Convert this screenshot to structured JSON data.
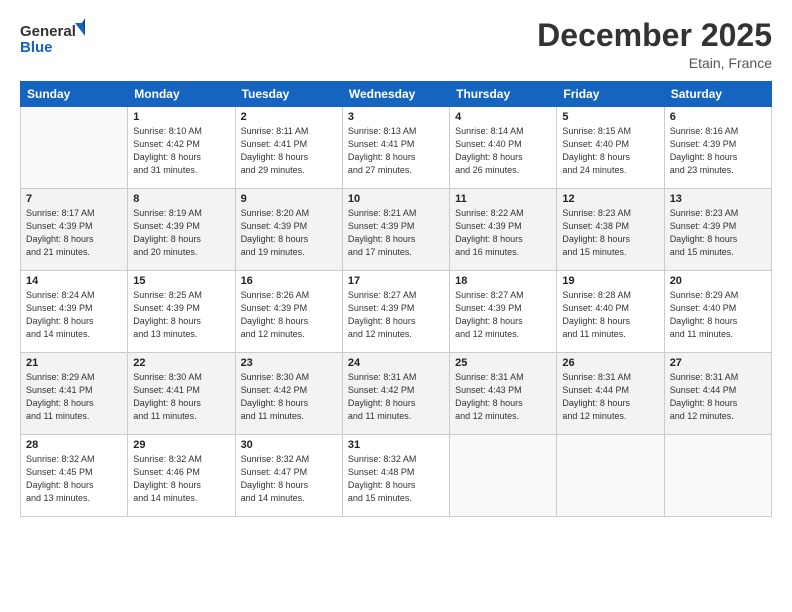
{
  "header": {
    "logo_line1": "General",
    "logo_line2": "Blue",
    "month": "December 2025",
    "location": "Etain, France"
  },
  "weekdays": [
    "Sunday",
    "Monday",
    "Tuesday",
    "Wednesday",
    "Thursday",
    "Friday",
    "Saturday"
  ],
  "weeks": [
    [
      {
        "day": "",
        "info": ""
      },
      {
        "day": "1",
        "info": "Sunrise: 8:10 AM\nSunset: 4:42 PM\nDaylight: 8 hours\nand 31 minutes."
      },
      {
        "day": "2",
        "info": "Sunrise: 8:11 AM\nSunset: 4:41 PM\nDaylight: 8 hours\nand 29 minutes."
      },
      {
        "day": "3",
        "info": "Sunrise: 8:13 AM\nSunset: 4:41 PM\nDaylight: 8 hours\nand 27 minutes."
      },
      {
        "day": "4",
        "info": "Sunrise: 8:14 AM\nSunset: 4:40 PM\nDaylight: 8 hours\nand 26 minutes."
      },
      {
        "day": "5",
        "info": "Sunrise: 8:15 AM\nSunset: 4:40 PM\nDaylight: 8 hours\nand 24 minutes."
      },
      {
        "day": "6",
        "info": "Sunrise: 8:16 AM\nSunset: 4:39 PM\nDaylight: 8 hours\nand 23 minutes."
      }
    ],
    [
      {
        "day": "7",
        "info": "Sunrise: 8:17 AM\nSunset: 4:39 PM\nDaylight: 8 hours\nand 21 minutes."
      },
      {
        "day": "8",
        "info": "Sunrise: 8:19 AM\nSunset: 4:39 PM\nDaylight: 8 hours\nand 20 minutes."
      },
      {
        "day": "9",
        "info": "Sunrise: 8:20 AM\nSunset: 4:39 PM\nDaylight: 8 hours\nand 19 minutes."
      },
      {
        "day": "10",
        "info": "Sunrise: 8:21 AM\nSunset: 4:39 PM\nDaylight: 8 hours\nand 17 minutes."
      },
      {
        "day": "11",
        "info": "Sunrise: 8:22 AM\nSunset: 4:39 PM\nDaylight: 8 hours\nand 16 minutes."
      },
      {
        "day": "12",
        "info": "Sunrise: 8:23 AM\nSunset: 4:38 PM\nDaylight: 8 hours\nand 15 minutes."
      },
      {
        "day": "13",
        "info": "Sunrise: 8:23 AM\nSunset: 4:39 PM\nDaylight: 8 hours\nand 15 minutes."
      }
    ],
    [
      {
        "day": "14",
        "info": "Sunrise: 8:24 AM\nSunset: 4:39 PM\nDaylight: 8 hours\nand 14 minutes."
      },
      {
        "day": "15",
        "info": "Sunrise: 8:25 AM\nSunset: 4:39 PM\nDaylight: 8 hours\nand 13 minutes."
      },
      {
        "day": "16",
        "info": "Sunrise: 8:26 AM\nSunset: 4:39 PM\nDaylight: 8 hours\nand 12 minutes."
      },
      {
        "day": "17",
        "info": "Sunrise: 8:27 AM\nSunset: 4:39 PM\nDaylight: 8 hours\nand 12 minutes."
      },
      {
        "day": "18",
        "info": "Sunrise: 8:27 AM\nSunset: 4:39 PM\nDaylight: 8 hours\nand 12 minutes."
      },
      {
        "day": "19",
        "info": "Sunrise: 8:28 AM\nSunset: 4:40 PM\nDaylight: 8 hours\nand 11 minutes."
      },
      {
        "day": "20",
        "info": "Sunrise: 8:29 AM\nSunset: 4:40 PM\nDaylight: 8 hours\nand 11 minutes."
      }
    ],
    [
      {
        "day": "21",
        "info": "Sunrise: 8:29 AM\nSunset: 4:41 PM\nDaylight: 8 hours\nand 11 minutes."
      },
      {
        "day": "22",
        "info": "Sunrise: 8:30 AM\nSunset: 4:41 PM\nDaylight: 8 hours\nand 11 minutes."
      },
      {
        "day": "23",
        "info": "Sunrise: 8:30 AM\nSunset: 4:42 PM\nDaylight: 8 hours\nand 11 minutes."
      },
      {
        "day": "24",
        "info": "Sunrise: 8:31 AM\nSunset: 4:42 PM\nDaylight: 8 hours\nand 11 minutes."
      },
      {
        "day": "25",
        "info": "Sunrise: 8:31 AM\nSunset: 4:43 PM\nDaylight: 8 hours\nand 12 minutes."
      },
      {
        "day": "26",
        "info": "Sunrise: 8:31 AM\nSunset: 4:44 PM\nDaylight: 8 hours\nand 12 minutes."
      },
      {
        "day": "27",
        "info": "Sunrise: 8:31 AM\nSunset: 4:44 PM\nDaylight: 8 hours\nand 12 minutes."
      }
    ],
    [
      {
        "day": "28",
        "info": "Sunrise: 8:32 AM\nSunset: 4:45 PM\nDaylight: 8 hours\nand 13 minutes."
      },
      {
        "day": "29",
        "info": "Sunrise: 8:32 AM\nSunset: 4:46 PM\nDaylight: 8 hours\nand 14 minutes."
      },
      {
        "day": "30",
        "info": "Sunrise: 8:32 AM\nSunset: 4:47 PM\nDaylight: 8 hours\nand 14 minutes."
      },
      {
        "day": "31",
        "info": "Sunrise: 8:32 AM\nSunset: 4:48 PM\nDaylight: 8 hours\nand 15 minutes."
      },
      {
        "day": "",
        "info": ""
      },
      {
        "day": "",
        "info": ""
      },
      {
        "day": "",
        "info": ""
      }
    ]
  ]
}
